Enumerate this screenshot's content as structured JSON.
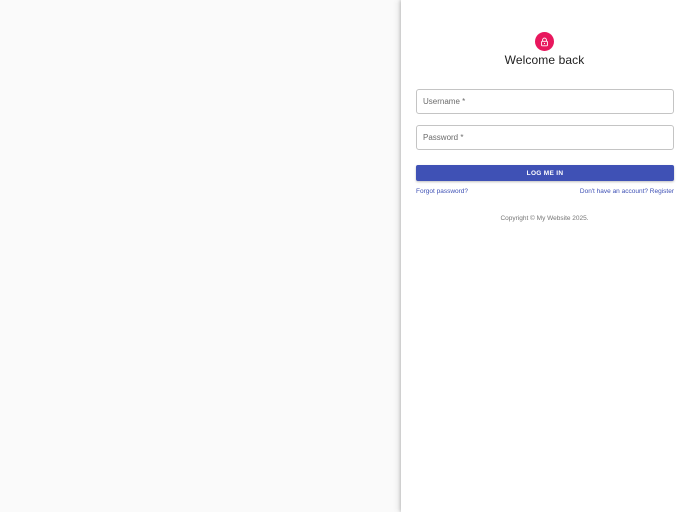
{
  "colors": {
    "page_background": "#fafafa",
    "panel_background": "#ffffff",
    "avatar": "#e8175d",
    "primary": "#3f51b5",
    "link": "#3f51b5"
  },
  "header": {
    "icon": "lock-icon",
    "title": "Welcome back"
  },
  "form": {
    "username_placeholder": "Username *",
    "username_value": "",
    "password_placeholder": "Password *",
    "password_value": "",
    "submit_label": "LOG ME IN"
  },
  "links": {
    "forgot_password": "Forgot password?",
    "register": "Don't have an account? Register"
  },
  "footer": {
    "copyright": "Copyright © My Website 2025."
  }
}
